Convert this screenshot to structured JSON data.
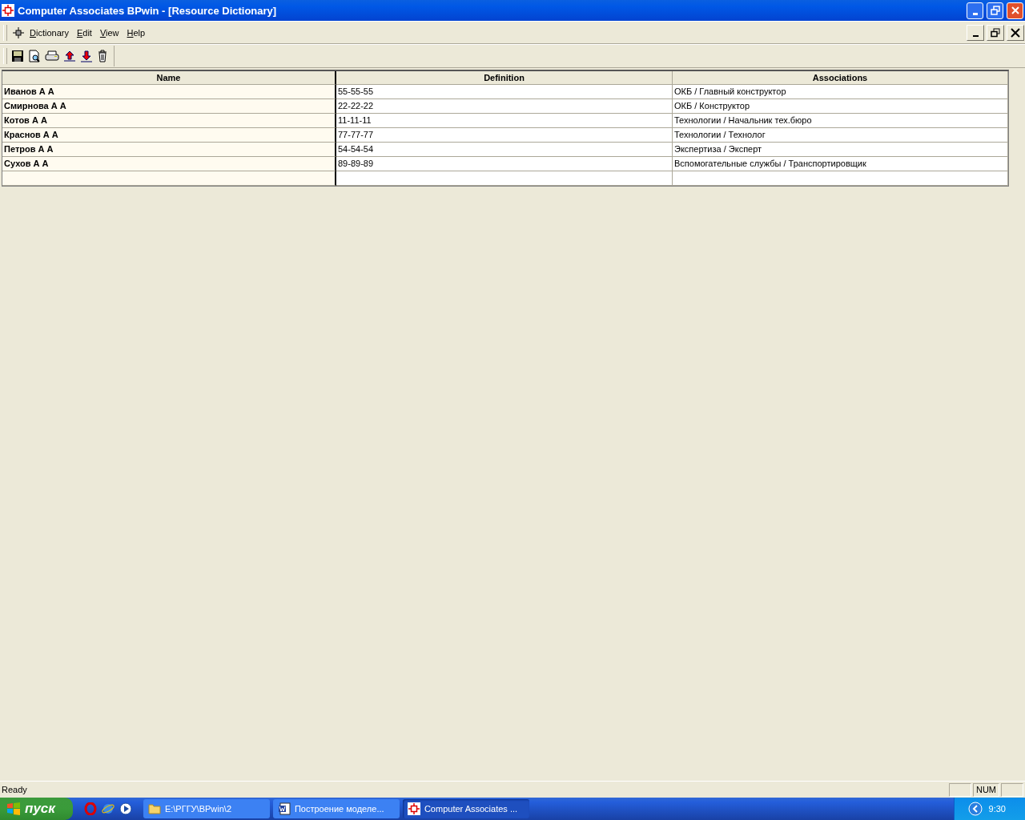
{
  "window": {
    "title": "Computer Associates BPwin - [Resource Dictionary]"
  },
  "menu": [
    "Dictionary",
    "Edit",
    "View",
    "Help"
  ],
  "table": {
    "columns": [
      "Name",
      "Definition",
      "Associations"
    ],
    "rows": [
      [
        "Иванов А А",
        "55-55-55",
        "ОКБ / Главный конструктор"
      ],
      [
        "Смирнова А А",
        "22-22-22",
        "ОКБ / Конструктор"
      ],
      [
        "Котов А А",
        "11-11-11",
        "Технологии / Начальник тех.бюро"
      ],
      [
        "Краснов А А",
        "77-77-77",
        "Технологии / Технолог"
      ],
      [
        "Петров А А",
        "54-54-54",
        "Экспертиза / Эксперт"
      ],
      [
        "Сухов А А",
        "89-89-89",
        "Вспомогательные службы / Транспортировщик"
      ]
    ]
  },
  "status_bar": {
    "message": "Ready",
    "indicators": [
      "NUM"
    ]
  },
  "taskbar": {
    "start": "пуск",
    "tasks": [
      {
        "kind": "folder",
        "label": "E:\\РГГУ\\BPwin\\2",
        "selected": false
      },
      {
        "kind": "word",
        "label": "Построение моделе...",
        "selected": false
      },
      {
        "kind": "app",
        "label": "Computer Associates ...",
        "selected": true
      }
    ],
    "clock": "9:30"
  }
}
